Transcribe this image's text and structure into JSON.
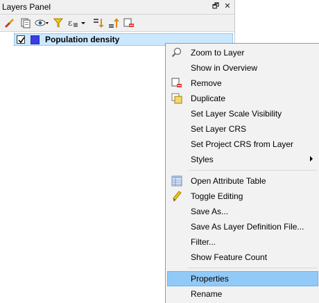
{
  "panel": {
    "title": "Layers Panel",
    "float_glyph": "🗗",
    "close_glyph": "✕"
  },
  "toolbar": {
    "icons": [
      "brush-icon",
      "add-group-icon",
      "eye-icon",
      "filter-icon",
      "expression-filter-icon",
      "expand-all-icon",
      "collapse-all-icon",
      "remove-layer-icon"
    ]
  },
  "layer": {
    "name": "Population density",
    "checked": true,
    "swatch_color": "#3c3ce6"
  },
  "menu": {
    "items": [
      {
        "label": "Zoom to Layer",
        "icon": "zoom-icon"
      },
      {
        "label": "Show in Overview",
        "icon": ""
      },
      {
        "label": "Remove",
        "icon": "remove-icon"
      },
      {
        "label": "Duplicate",
        "icon": "duplicate-icon"
      },
      {
        "label": "Set Layer Scale Visibility",
        "icon": ""
      },
      {
        "label": "Set Layer CRS",
        "icon": ""
      },
      {
        "label": "Set Project CRS from Layer",
        "icon": ""
      },
      {
        "label": "Styles",
        "icon": "",
        "submenu": true
      },
      {
        "label": "Open Attribute Table",
        "icon": "table-icon"
      },
      {
        "label": "Toggle Editing",
        "icon": "pencil-icon"
      },
      {
        "label": "Save As...",
        "icon": ""
      },
      {
        "label": "Save As Layer Definition File...",
        "icon": ""
      },
      {
        "label": "Filter...",
        "icon": ""
      },
      {
        "label": "Show Feature Count",
        "icon": ""
      },
      {
        "label": "Properties",
        "icon": "",
        "highlighted": true
      },
      {
        "label": "Rename",
        "icon": ""
      }
    ]
  },
  "colors": {
    "highlight": "#91c9f7",
    "selection": "#cce8ff"
  }
}
